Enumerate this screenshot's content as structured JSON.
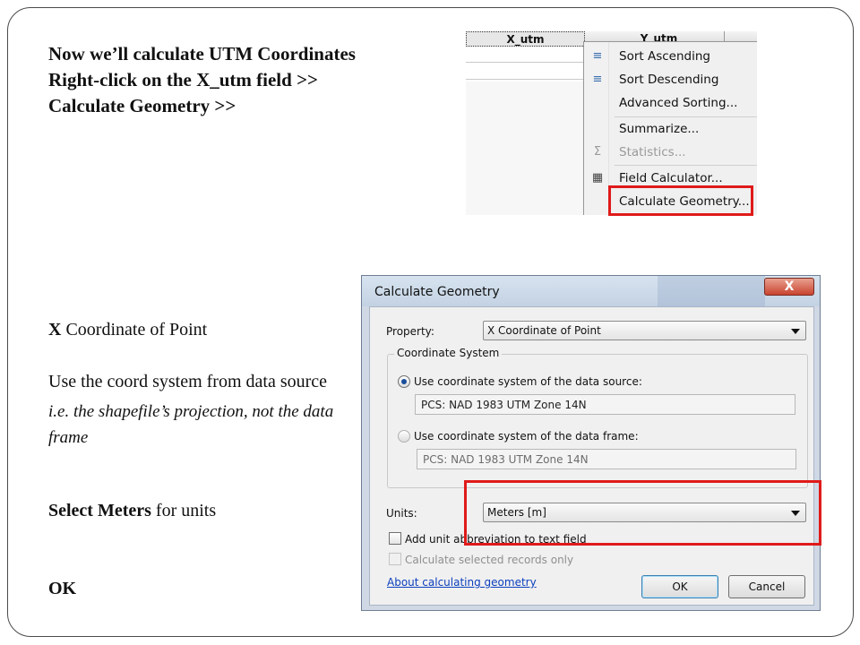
{
  "intro": {
    "line1": "Now we’ll calculate UTM Coordinates",
    "line2": "Right-click on the X_utm field >>",
    "line3": "Calculate Geometry >>"
  },
  "notes": {
    "x_coord_bold": "X",
    "x_coord_rest": " Coordinate of Point",
    "coord_system": "Use the coord system from data source",
    "coord_system_italic": "i.e. the shapefile’s projection, not the data frame",
    "meters_bold": "Select Meters",
    "meters_rest": " for units",
    "ok": "OK"
  },
  "table": {
    "columns": [
      "X_utm",
      "Y_utm"
    ]
  },
  "context_menu": {
    "items": [
      {
        "label": "Sort Ascending",
        "icon": "sort-ascending-icon",
        "glyph": "≡",
        "enabled": true
      },
      {
        "label": "Sort Descending",
        "icon": "sort-descending-icon",
        "glyph": "≡",
        "enabled": true
      },
      {
        "label": "Advanced Sorting...",
        "icon": "",
        "glyph": "",
        "enabled": true
      },
      {
        "label": "Summarize...",
        "icon": "",
        "glyph": "",
        "enabled": true
      },
      {
        "label": "Statistics...",
        "icon": "sigma-icon",
        "glyph": "Σ",
        "enabled": false
      },
      {
        "label": "Field Calculator...",
        "icon": "calculator-icon",
        "glyph": "▦",
        "enabled": true
      },
      {
        "label": "Calculate Geometry...",
        "icon": "",
        "glyph": "",
        "enabled": true
      }
    ]
  },
  "dialog": {
    "title": "Calculate Geometry",
    "close_glyph": "X",
    "property_label": "Property:",
    "property_value": "X Coordinate of Point",
    "coord_group_title": "Coordinate System",
    "radio_source_label": "Use coordinate system of the data source:",
    "source_pcs": "PCS: NAD 1983 UTM Zone 14N",
    "radio_frame_label": "Use coordinate system of the data frame:",
    "frame_pcs": "PCS: NAD 1983 UTM Zone 14N",
    "units_label": "Units:",
    "units_value": "Meters [m]",
    "add_unit_label": "Add unit abbreviation to text field",
    "selected_only_label": "Calculate selected records only",
    "about_link": "About calculating geometry",
    "ok_label": "OK",
    "cancel_label": "Cancel"
  },
  "colors": {
    "highlight": "#e01a1a",
    "link": "#0b3fbd",
    "dialog_frame": "#cfd8e4"
  }
}
